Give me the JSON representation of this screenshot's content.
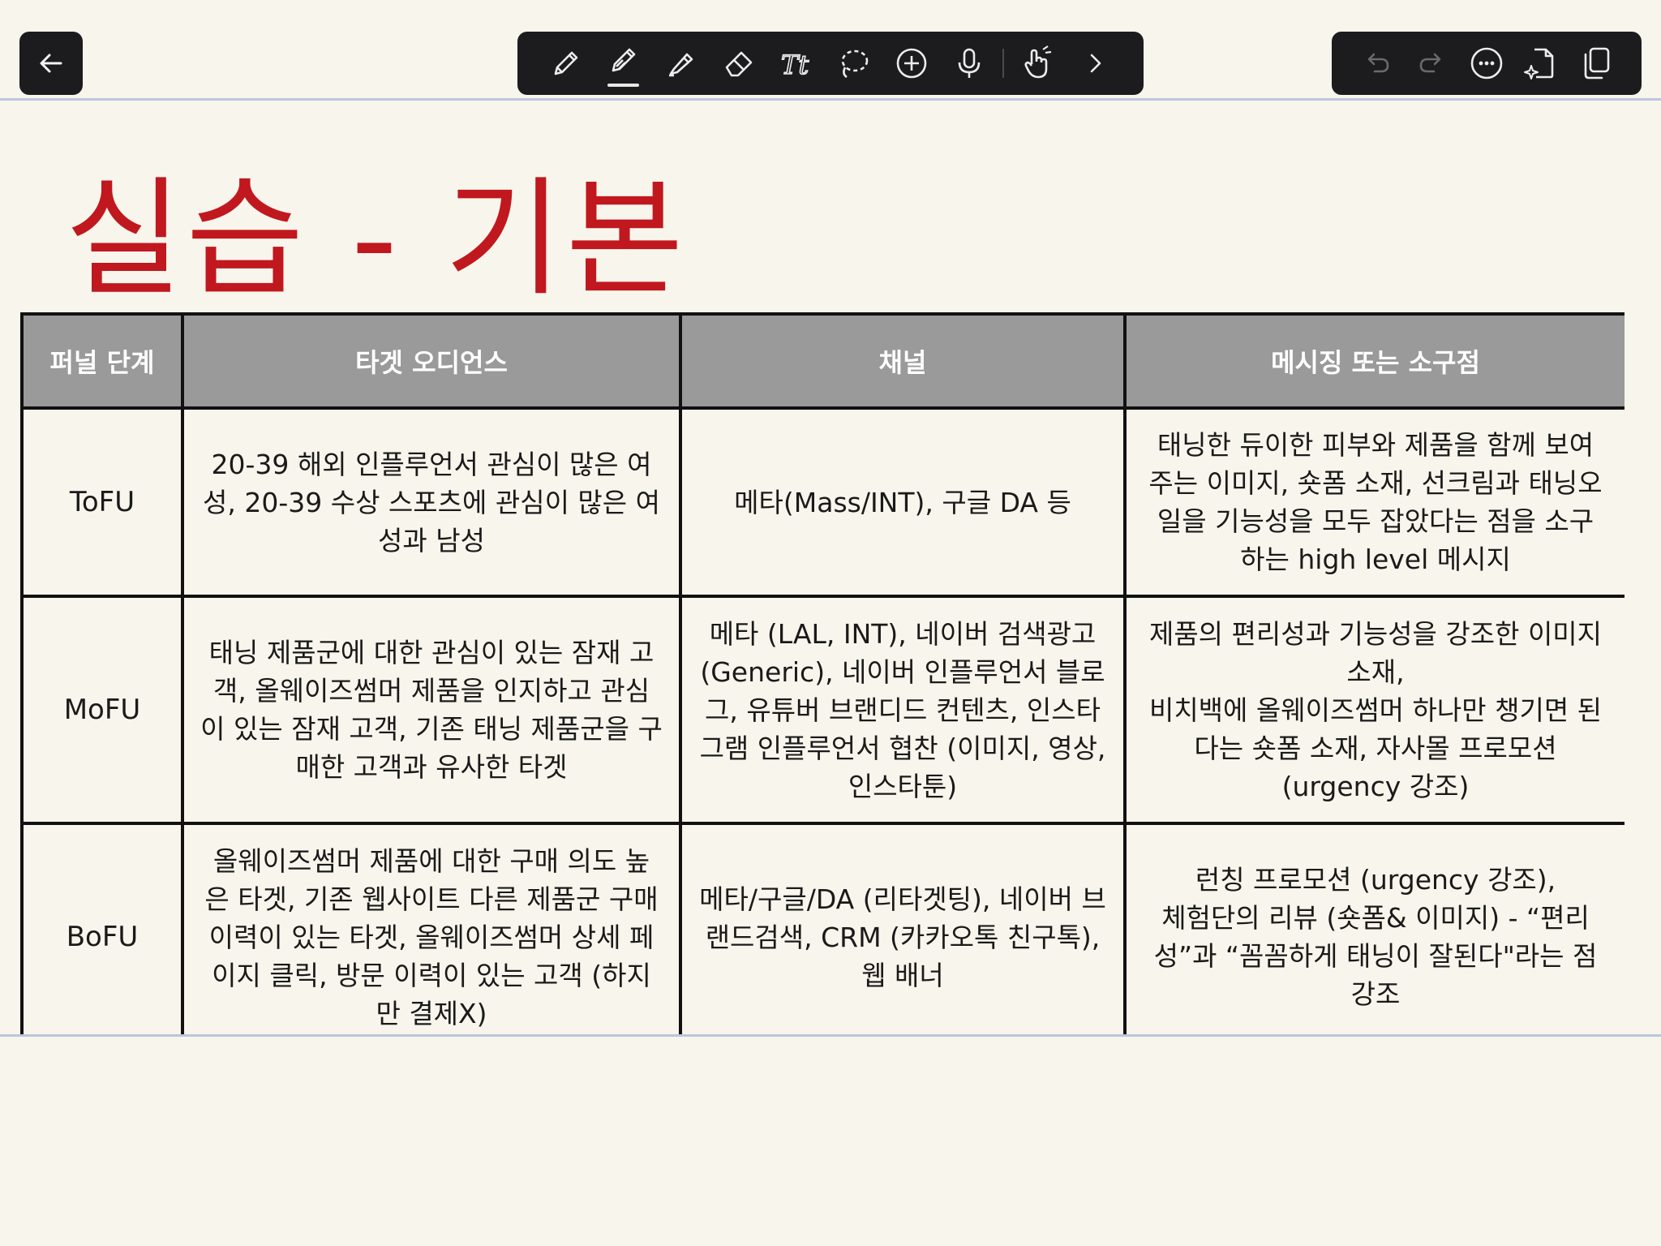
{
  "toolbar": {
    "left": {
      "back_icon": "arrow-left-icon"
    },
    "center_tools": [
      {
        "name": "pen-tool",
        "icon": "pencil-icon",
        "active": false
      },
      {
        "name": "pen-tool-active",
        "icon": "pencil-underline-icon",
        "active": true
      },
      {
        "name": "highlighter-tool",
        "icon": "highlighter-icon",
        "active": false
      },
      {
        "name": "eraser-tool",
        "icon": "eraser-icon",
        "active": false
      },
      {
        "name": "text-tool",
        "icon": "text-tt-icon",
        "active": false
      },
      {
        "name": "lasso-tool",
        "icon": "lasso-icon",
        "active": false
      },
      {
        "name": "add-tool",
        "icon": "plus-circle-icon",
        "active": false
      },
      {
        "name": "mic-tool",
        "icon": "microphone-icon",
        "active": false
      },
      {
        "name": "touch-tool",
        "icon": "hand-pointer-icon",
        "active": false
      },
      {
        "name": "more-tools",
        "icon": "chevron-right-icon",
        "active": false
      }
    ],
    "right_tools": [
      {
        "name": "undo",
        "icon": "undo-icon",
        "enabled": false
      },
      {
        "name": "redo",
        "icon": "redo-icon",
        "enabled": false
      },
      {
        "name": "more",
        "icon": "ellipsis-circle-icon",
        "enabled": true
      },
      {
        "name": "ai-page",
        "icon": "sparkle-page-icon",
        "enabled": true
      },
      {
        "name": "pages",
        "icon": "copy-pages-icon",
        "enabled": true
      }
    ]
  },
  "page": {
    "title": "실습 - 기본"
  },
  "table": {
    "headers": [
      "퍼널 단계",
      "타겟 오디언스",
      "채널",
      "메시징 또는 소구점"
    ],
    "rows": [
      {
        "stage": "ToFU",
        "audience": "20-39 해외 인플루언서 관심이 많은 여\n성, 20-39 수상 스포츠에 관심이 많은 여\n성과 남성",
        "channel": "메타(Mass/INT), 구글 DA 등",
        "message": "태닝한 듀이한 피부와 제품을 함께 보여\n주는 이미지, 숏폼 소재, 선크림과 태닝오\n일을 기능성을 모두 잡았다는 점을 소구\n하는 high level 메시지"
      },
      {
        "stage": "MoFU",
        "audience": "태닝 제품군에 대한 관심이 있는 잠재 고\n객, 올웨이즈썸머 제품을 인지하고 관심\n이 있는 잠재 고객, 기존 태닝 제품군을 구\n매한 고객과 유사한 타겟",
        "channel": "메타 (LAL, INT), 네이버 검색광고\n(Generic), 네이버 인플루언서 블로\n그, 유튜버 브랜디드 컨텐츠, 인스타\n그램 인플루언서 협찬 (이미지, 영상,\n인스타툰)",
        "message": "제품의 편리성과 기능성을 강조한 이미지\n소재,\n비치백에 올웨이즈썸머 하나만 챙기면 된\n다는 숏폼 소재, 자사몰 프로모션\n(urgency 강조)"
      },
      {
        "stage": "BoFU",
        "audience": "올웨이즈썸머 제품에 대한 구매 의도 높\n은 타겟, 기존 웹사이트 다른 제품군 구매\n이력이 있는 타겟, 올웨이즈썸머 상세 페\n이지 클릭, 방문 이력이 있는 고객 (하지\n만 결제X)",
        "channel": "메타/구글/DA (리타겟팅), 네이버 브\n랜드검색, CRM (카카오톡 친구톡),\n웹 배너",
        "message": "런칭 프로모션 (urgency 강조),\n체험단의 리뷰 (숏폼& 이미지) - “편리\n성”과 “꼼꼼하게 태닝이 잘된다\"라는 점\n강조"
      }
    ]
  },
  "colors": {
    "background": "#f8f5ec",
    "title": "#c0181e",
    "header_bg": "#9a9a9a",
    "toolbar_bg": "#1c1c1e",
    "guide_line": "#b9c7dc"
  }
}
